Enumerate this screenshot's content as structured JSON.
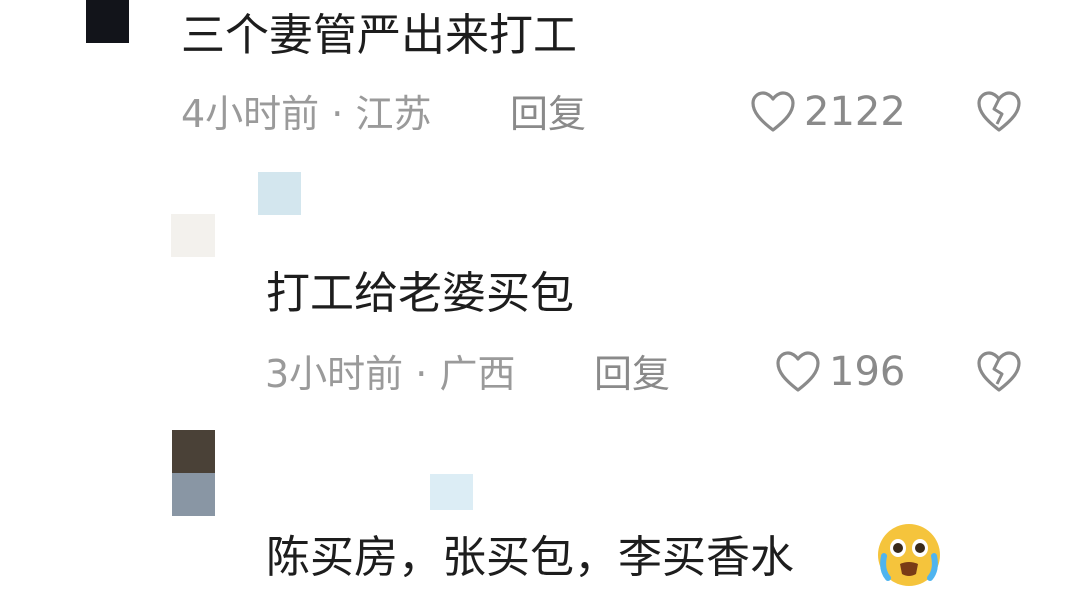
{
  "comments": [
    {
      "text": "三个妻管严出来打工",
      "time": "4小时前",
      "location": "江苏",
      "reply_label": "回复",
      "likes": "2122"
    },
    {
      "text": "打工给老婆买包",
      "time": "3小时前",
      "location": "广西",
      "reply_label": "回复",
      "likes": "196"
    },
    {
      "text": "陈买房，张买包，李买香水"
    }
  ],
  "separator": "·",
  "icons": {
    "like": "heart-outline-icon",
    "dislike": "broken-heart-icon",
    "emoji": "crying-face-emoji"
  },
  "colors": {
    "text": "#1d1d1d",
    "meta": "#9a9a9a",
    "icon": "#8a8a8a"
  }
}
